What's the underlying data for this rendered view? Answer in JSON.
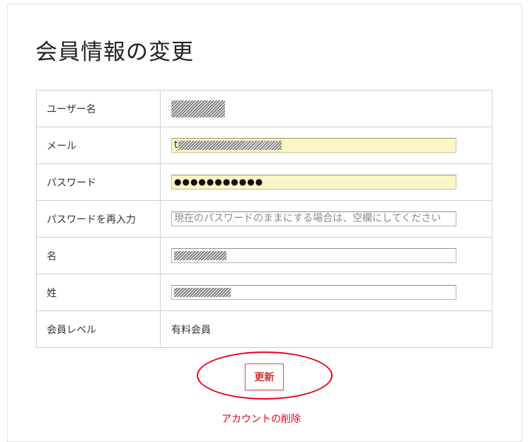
{
  "page": {
    "title": "会員情報の変更"
  },
  "form": {
    "rows": [
      {
        "label": "ユーザー名"
      },
      {
        "label": "メール",
        "value_prefix": "t"
      },
      {
        "label": "パスワード",
        "value": "●●●●●●●●●●●"
      },
      {
        "label": "パスワードを再入力",
        "placeholder": "現在のパスワードのままにする場合は、空欄にしてください"
      },
      {
        "label": "名"
      },
      {
        "label": "姓"
      },
      {
        "label": "会員レベル",
        "value": "有料会員"
      }
    ]
  },
  "actions": {
    "update_label": "更新",
    "delete_label": "アカウントの削除"
  },
  "colors": {
    "accent": "#e8001c",
    "autofill_background": "#fbf6c6",
    "border": "#cfcfcf"
  }
}
